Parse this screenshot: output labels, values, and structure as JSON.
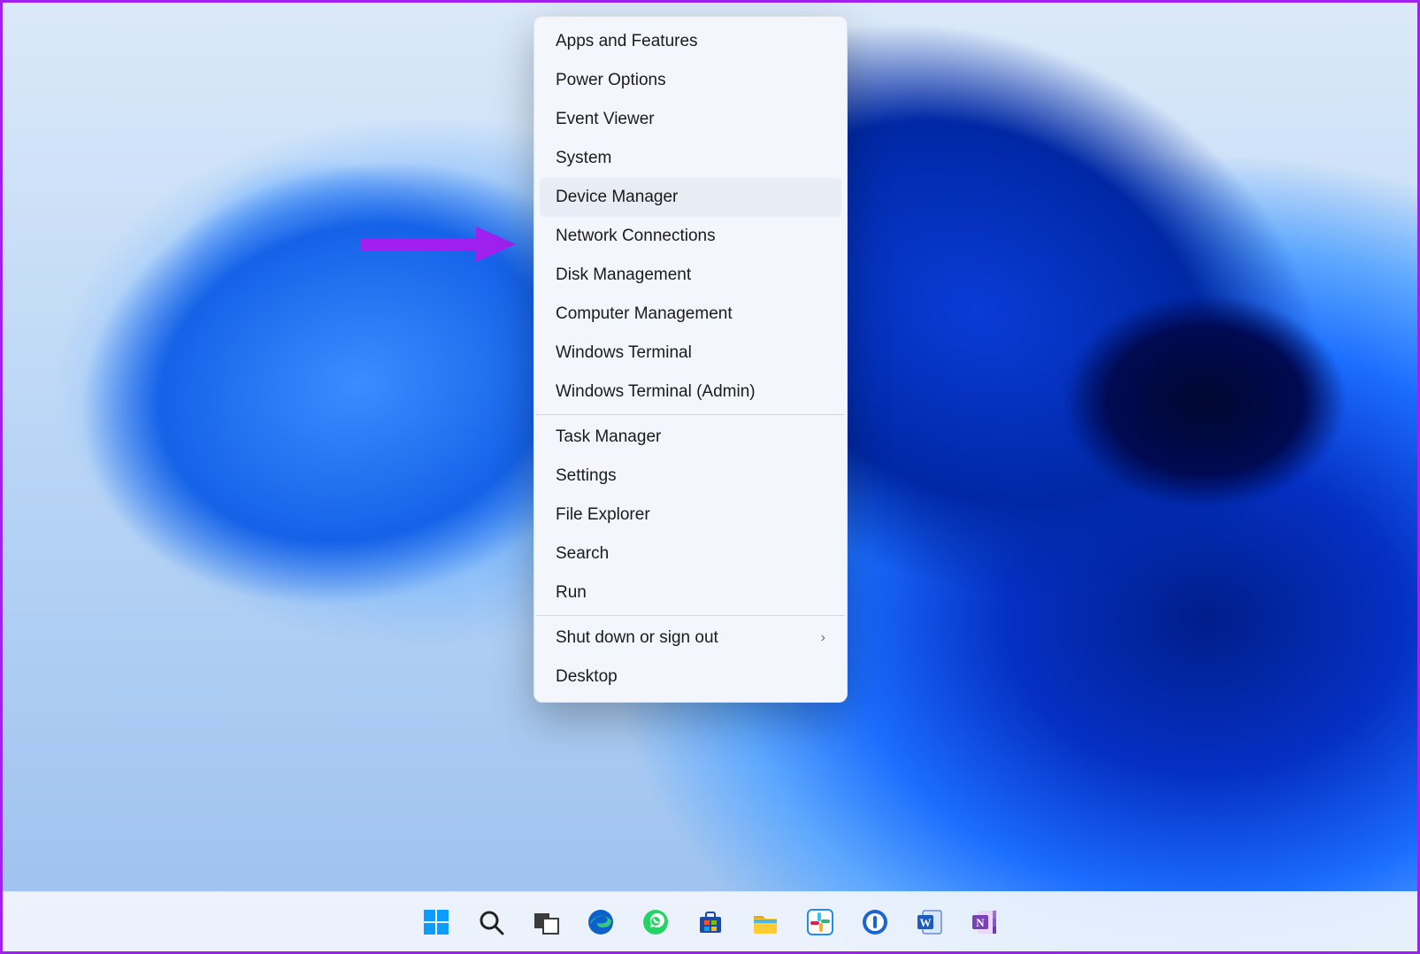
{
  "menu": {
    "groups": [
      [
        {
          "label": "Apps and Features",
          "hovered": false,
          "hasSubmenu": false
        },
        {
          "label": "Power Options",
          "hovered": false,
          "hasSubmenu": false
        },
        {
          "label": "Event Viewer",
          "hovered": false,
          "hasSubmenu": false
        },
        {
          "label": "System",
          "hovered": false,
          "hasSubmenu": false
        },
        {
          "label": "Device Manager",
          "hovered": true,
          "hasSubmenu": false
        },
        {
          "label": "Network Connections",
          "hovered": false,
          "hasSubmenu": false
        },
        {
          "label": "Disk Management",
          "hovered": false,
          "hasSubmenu": false
        },
        {
          "label": "Computer Management",
          "hovered": false,
          "hasSubmenu": false
        },
        {
          "label": "Windows Terminal",
          "hovered": false,
          "hasSubmenu": false
        },
        {
          "label": "Windows Terminal (Admin)",
          "hovered": false,
          "hasSubmenu": false
        }
      ],
      [
        {
          "label": "Task Manager",
          "hovered": false,
          "hasSubmenu": false
        },
        {
          "label": "Settings",
          "hovered": false,
          "hasSubmenu": false
        },
        {
          "label": "File Explorer",
          "hovered": false,
          "hasSubmenu": false
        },
        {
          "label": "Search",
          "hovered": false,
          "hasSubmenu": false
        },
        {
          "label": "Run",
          "hovered": false,
          "hasSubmenu": false
        }
      ],
      [
        {
          "label": "Shut down or sign out",
          "hovered": false,
          "hasSubmenu": true
        },
        {
          "label": "Desktop",
          "hovered": false,
          "hasSubmenu": false
        }
      ]
    ]
  },
  "taskbar": {
    "icons": [
      {
        "name": "start-icon",
        "kind": "start"
      },
      {
        "name": "search-icon",
        "kind": "search"
      },
      {
        "name": "task-view-icon",
        "kind": "taskview"
      },
      {
        "name": "edge-browser-icon",
        "kind": "edge"
      },
      {
        "name": "whatsapp-icon",
        "kind": "whatsapp"
      },
      {
        "name": "microsoft-store-icon",
        "kind": "store"
      },
      {
        "name": "file-explorer-icon",
        "kind": "explorer"
      },
      {
        "name": "slack-icon",
        "kind": "slack"
      },
      {
        "name": "onepassword-icon",
        "kind": "onepassword"
      },
      {
        "name": "word-icon",
        "kind": "word"
      },
      {
        "name": "onenote-icon",
        "kind": "onenote"
      }
    ]
  },
  "annotation": {
    "arrow_color": "#a020f0"
  }
}
